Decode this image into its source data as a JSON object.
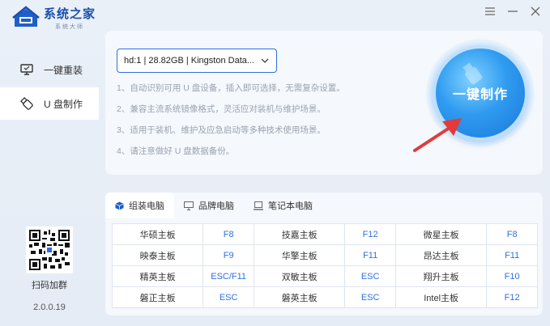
{
  "app": {
    "logo_title": "系统之家",
    "logo_sub": "系统大师",
    "version": "2.0.0.19"
  },
  "sidebar": {
    "items": [
      {
        "label": "一键重装",
        "icon": "monitor-icon",
        "active": false
      },
      {
        "label": "U 盘制作",
        "icon": "usb-icon",
        "active": true
      }
    ],
    "qr_label": "扫码加群"
  },
  "window_controls": [
    "menu-icon",
    "minimize-icon",
    "close-icon"
  ],
  "device_select": {
    "value": "hd:1 | 28.82GB | Kingston Data..."
  },
  "tips": [
    "1、自动识别可用 U 盘设备，插入即可选择，无需复杂设置。",
    "2、兼容主流系统镜像格式，灵活应对装机与维护场景。",
    "3、适用于装机、维护及应急启动等多种技术使用场景。",
    "4、请注意做好 U 盘数据备份。"
  ],
  "make_button": {
    "label": "一键制作"
  },
  "tabs": [
    {
      "label": "组装电脑",
      "icon": "cube-icon",
      "active": true
    },
    {
      "label": "品牌电脑",
      "icon": "desktop-icon",
      "active": false
    },
    {
      "label": "笔记本电脑",
      "icon": "laptop-icon",
      "active": false
    }
  ],
  "hotkey_table": [
    [
      {
        "brand": "华硕主板",
        "key": "F8"
      },
      {
        "brand": "技嘉主板",
        "key": "F12"
      },
      {
        "brand": "微星主板",
        "key": "F8"
      }
    ],
    [
      {
        "brand": "映泰主板",
        "key": "F9"
      },
      {
        "brand": "华擎主板",
        "key": "F11"
      },
      {
        "brand": "昂达主板",
        "key": "F11"
      }
    ],
    [
      {
        "brand": "精英主板",
        "key": "ESC/F11"
      },
      {
        "brand": "双敏主板",
        "key": "ESC"
      },
      {
        "brand": "翔升主板",
        "key": "F10"
      }
    ],
    [
      {
        "brand": "磐正主板",
        "key": "ESC"
      },
      {
        "brand": "磐英主板",
        "key": "ESC"
      },
      {
        "brand": "Intel主板",
        "key": "F12"
      }
    ]
  ],
  "colors": {
    "accent": "#2f6fe0",
    "background": "#e8eef6",
    "panel": "#f5f8fc",
    "orb": "#2f9bf0",
    "arrow": "#e23b3b"
  }
}
